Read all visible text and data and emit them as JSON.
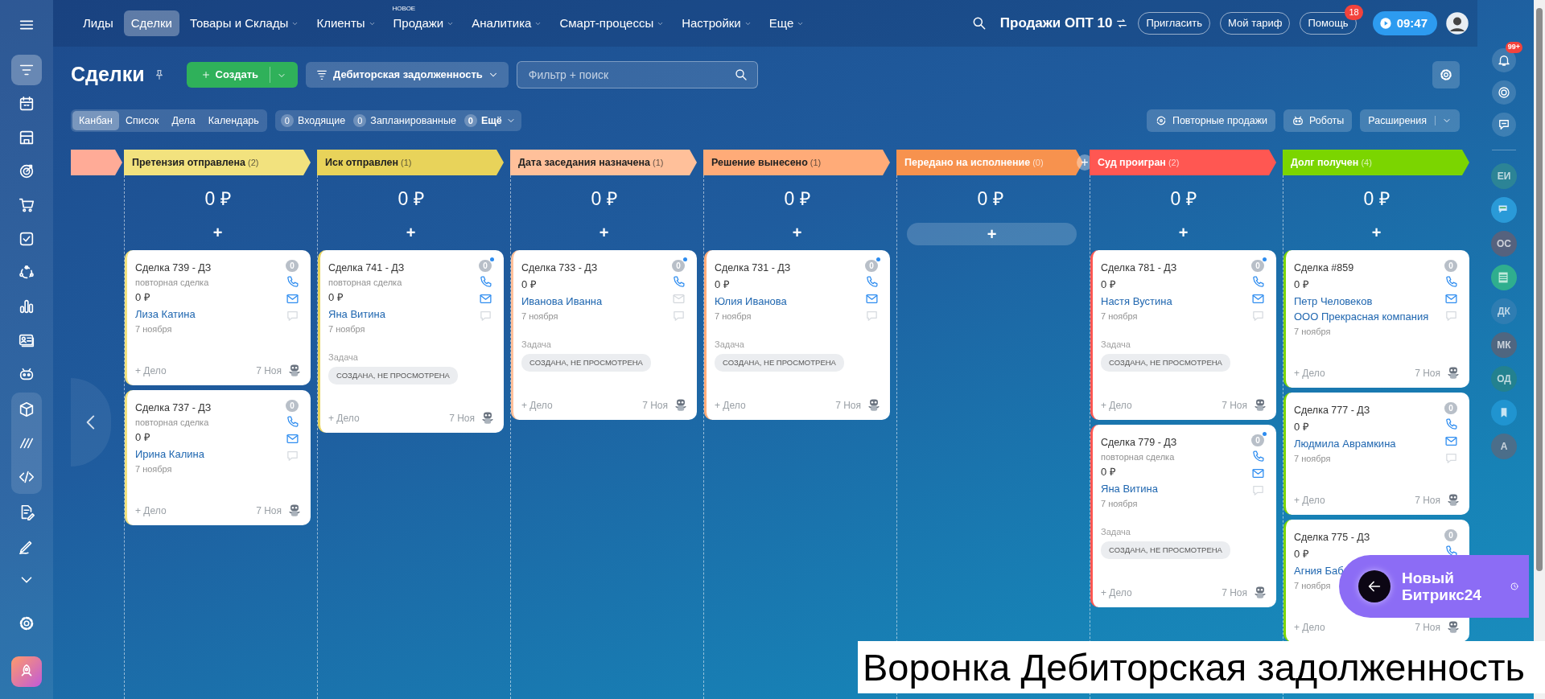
{
  "left_sidebar": {
    "items": [
      {
        "selected": false
      },
      {
        "selected": true
      },
      {
        "selected": false
      },
      {
        "selected": false
      },
      {
        "selected": false
      },
      {
        "selected": false
      },
      {
        "selected": false
      },
      {
        "selected": false
      },
      {
        "selected": false
      },
      {
        "selected": false
      },
      {
        "selected": false
      },
      {
        "selected": false
      },
      {
        "selected": false
      },
      {
        "selected": false
      },
      {
        "selected": false
      },
      {
        "selected": false
      },
      {
        "selected": false
      },
      {
        "selected": false
      }
    ]
  },
  "top_nav": {
    "items": [
      {
        "label": "Лиды",
        "selected": false,
        "dropdown": false
      },
      {
        "label": "Сделки",
        "selected": true,
        "dropdown": false
      },
      {
        "label": "Товары и Склады",
        "selected": false,
        "dropdown": true
      },
      {
        "label": "Клиенты",
        "selected": false,
        "dropdown": true
      },
      {
        "label": "Продажи",
        "selected": false,
        "dropdown": true,
        "tag": "НОВОЕ"
      },
      {
        "label": "Аналитика",
        "selected": false,
        "dropdown": true
      },
      {
        "label": "Смарт-процессы",
        "selected": false,
        "dropdown": true
      },
      {
        "label": "Настройки",
        "selected": false,
        "dropdown": true
      },
      {
        "label": "Еще",
        "selected": false,
        "dropdown": true
      }
    ],
    "portal": "Продажи ОПТ 10",
    "buttons": [
      {
        "label": "Пригласить"
      },
      {
        "label": "Мой тариф"
      },
      {
        "label": "Помощь",
        "badge": "18"
      }
    ],
    "time": "09:47"
  },
  "toolbar": {
    "title": "Сделки",
    "create_button": "Создать",
    "pipeline": "Дебиторская задолженность",
    "search": {
      "placeholder": "Фильтр + поиск"
    }
  },
  "view_bar": {
    "views": [
      {
        "label": "Канбан",
        "selected": true
      },
      {
        "label": "Список",
        "selected": false
      },
      {
        "label": "Дела",
        "selected": false
      },
      {
        "label": "Календарь",
        "selected": false
      }
    ],
    "counters": [
      {
        "count": "0",
        "label": "Входящие",
        "dropdown": false
      },
      {
        "count": "0",
        "label": "Запланированные",
        "dropdown": false
      },
      {
        "count": "0",
        "label": "Ещё",
        "dropdown": true
      }
    ],
    "actions": [
      {
        "label": "Повторные продажи",
        "kind": "repeat"
      },
      {
        "label": "Роботы",
        "kind": "robot"
      },
      {
        "label": "Расширения",
        "kind": "split"
      }
    ]
  },
  "stages": [
    {
      "kind": "partial",
      "color": "#ffab97"
    },
    {
      "kind": "stage",
      "title": "Претензия отправлена",
      "count": "(2)",
      "color": "#f2e27e",
      "total": "0 ₽",
      "add_button": "+",
      "add_highlighted": false,
      "cards": [
        {
          "title": "Сделка 739 - ДЗ",
          "subtitle": "повторная сделка",
          "amount": "0 ₽",
          "contacts": [
            "Лиза Катина"
          ],
          "date": "7 ноября",
          "counter": "0",
          "unread": false,
          "email": true,
          "footer_add": "+ Дело",
          "footer_date": "7 Ноя"
        },
        {
          "title": "Сделка 737 - ДЗ",
          "subtitle": "повторная сделка",
          "amount": "0 ₽",
          "contacts": [
            "Ирина Калина"
          ],
          "date": "7 ноября",
          "counter": "0",
          "unread": false,
          "email": true,
          "footer_add": "+ Дело",
          "footer_date": "7 Ноя"
        }
      ]
    },
    {
      "kind": "stage",
      "title": "Иск отправлен",
      "count": "(1)",
      "color": "#e8d35a",
      "total": "0 ₽",
      "add_button": "+",
      "add_highlighted": false,
      "cards": [
        {
          "title": "Сделка 741 - ДЗ",
          "subtitle": "повторная сделка",
          "amount": "0 ₽",
          "contacts": [
            "Яна Витина"
          ],
          "date": "7 ноября",
          "task_label": "Задача",
          "task_status": "СОЗДАНА, НЕ ПРОСМОТРЕНА",
          "counter": "0",
          "unread": true,
          "email": true,
          "footer_add": "+ Дело",
          "footer_date": "7 Ноя"
        }
      ]
    },
    {
      "kind": "stage",
      "title": "Дата заседания назначена",
      "count": "(1)",
      "color": "#ffc09a",
      "total": "0 ₽",
      "add_button": "+",
      "add_highlighted": false,
      "cards": [
        {
          "title": "Сделка 733 - ДЗ",
          "amount": "0 ₽",
          "contacts": [
            "Иванова Иванна"
          ],
          "date": "7 ноября",
          "task_label": "Задача",
          "task_status": "СОЗДАНА, НЕ ПРОСМОТРЕНА",
          "counter": "0",
          "unread": true,
          "email": false,
          "footer_add": "+ Дело",
          "footer_date": "7 Ноя"
        }
      ]
    },
    {
      "kind": "stage",
      "title": "Решение вынесено",
      "count": "(1)",
      "color": "#ffab78",
      "total": "0 ₽",
      "add_button": "+",
      "add_highlighted": false,
      "cards": [
        {
          "title": "Сделка 731 - ДЗ",
          "amount": "0 ₽",
          "contacts": [
            "Юлия Иванова"
          ],
          "date": "7 ноября",
          "task_label": "Задача",
          "task_status": "СОЗДАНА, НЕ ПРОСМОТРЕНА",
          "counter": "0",
          "unread": true,
          "email": true,
          "footer_add": "+ Дело",
          "footer_date": "7 Ноя"
        }
      ]
    },
    {
      "kind": "stage",
      "title": "Передано на исполнение",
      "count": "(0)",
      "color": "#f7924e",
      "total": "0 ₽",
      "add_button": "+",
      "add_highlighted": true,
      "header_add": "+"
    },
    {
      "kind": "stage",
      "title": "Суд проигран",
      "count": "(2)",
      "color": "#ff5752",
      "total": "0 ₽",
      "add_button": "+",
      "add_highlighted": false,
      "cards": [
        {
          "title": "Сделка 781 - ДЗ",
          "amount": "0 ₽",
          "contacts": [
            "Настя Вустина"
          ],
          "date": "7 ноября",
          "task_label": "Задача",
          "task_status": "СОЗДАНА, НЕ ПРОСМОТРЕНА",
          "counter": "0",
          "unread": true,
          "email": true,
          "footer_add": "+ Дело",
          "footer_date": "7 Ноя"
        },
        {
          "title": "Сделка 779 - ДЗ",
          "subtitle": "повторная сделка",
          "amount": "0 ₽",
          "contacts": [
            "Яна Витина"
          ],
          "date": "7 ноября",
          "task_label": "Задача",
          "task_status": "СОЗДАНА, НЕ ПРОСМОТРЕНА",
          "counter": "0",
          "unread": true,
          "email": true,
          "footer_add": "+ Дело",
          "footer_date": "7 Ноя"
        }
      ]
    },
    {
      "kind": "stage",
      "title": "Долг получен",
      "count": "(4)",
      "color": "#7bd500",
      "total": "0 ₽",
      "add_button": "+",
      "add_highlighted": false,
      "cards": [
        {
          "title": "Сделка #859",
          "amount": "0 ₽",
          "contacts": [
            "Петр Человеков",
            "ООО Прекрасная компания"
          ],
          "date": "7 ноября",
          "counter": "0",
          "unread": false,
          "email": true,
          "footer_add": "+ Дело",
          "footer_date": "7 Ноя"
        },
        {
          "title": "Сделка 777 - ДЗ",
          "amount": "0 ₽",
          "contacts": [
            "Людмила Аврамкина"
          ],
          "date": "7 ноября",
          "counter": "0",
          "unread": false,
          "email": true,
          "footer_add": "+ Дело",
          "footer_date": "7 Ноя"
        },
        {
          "title": "Сделка 775 - ДЗ",
          "amount": "0 ₽",
          "contacts": [
            "Агния Баб"
          ],
          "date": "7 ноября",
          "counter": "0",
          "unread": false,
          "footer_add": "+ Дело",
          "footer_date": "7 Ноя"
        }
      ]
    }
  ],
  "right_sidebar": {
    "notifications_badge": "99+",
    "avatars": [
      {
        "kind": "initials",
        "text": "ЕИ",
        "color": "#2c8496"
      },
      {
        "kind": "chat",
        "color": "#2a9ad8"
      },
      {
        "kind": "initials",
        "text": "ОС",
        "color": "#55627e"
      },
      {
        "kind": "news",
        "color": "#2fae8e"
      },
      {
        "kind": "initials",
        "text": "ДК",
        "color": "#2f7db2"
      },
      {
        "kind": "initials",
        "text": "МК",
        "color": "#4f6680"
      },
      {
        "kind": "initials",
        "text": "ОД",
        "color": "#23818f"
      },
      {
        "kind": "bookmark",
        "color": "#2094d0"
      },
      {
        "kind": "initials",
        "text": "А",
        "color": "#4b6e8a"
      }
    ]
  },
  "new_ui_banner": {
    "text": "Новый Битрикс24"
  },
  "caption": "Воронка Дебиторская задолженность"
}
